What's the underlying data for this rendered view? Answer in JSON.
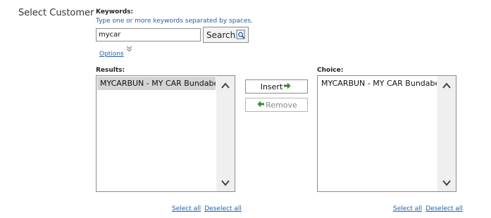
{
  "section_title": "Select Customer",
  "keywords": {
    "label": "Keywords:",
    "hint": "Type one or more keywords separated by spaces.",
    "value": "mycar",
    "search_label": "Search"
  },
  "options_label": "Options",
  "results": {
    "label": "Results:",
    "items": [
      "MYCARBUN - MY CAR Bundaberg"
    ],
    "select_all": "Select all",
    "deselect_all": "Deselect all"
  },
  "choice": {
    "label": "Choice:",
    "items": [
      "MYCARBUN - MY CAR Bundaberg"
    ],
    "select_all": "Select all",
    "deselect_all": "Deselect all"
  },
  "buttons": {
    "insert": "Insert",
    "remove": "Remove"
  },
  "colors": {
    "link": "#1f5fa8",
    "arrow_green": "#2e8b2e",
    "selected_row": "#d4d4d4"
  },
  "icons": [
    "search-icon",
    "chevron-down-icon",
    "arrow-right-icon",
    "arrow-left-icon",
    "scroll-up-icon",
    "scroll-down-icon"
  ]
}
